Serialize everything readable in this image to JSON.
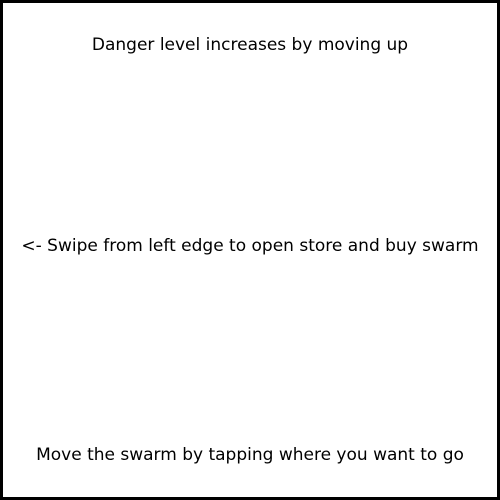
{
  "tutorial": {
    "danger_hint": "Danger level increases by moving up",
    "store_hint": "<- Swipe from left edge to open store and buy swarm",
    "move_hint": "Move the swarm by tapping where you want to go"
  },
  "colors": {
    "background": "#ffffff",
    "border": "#000000",
    "text": "#000000"
  }
}
